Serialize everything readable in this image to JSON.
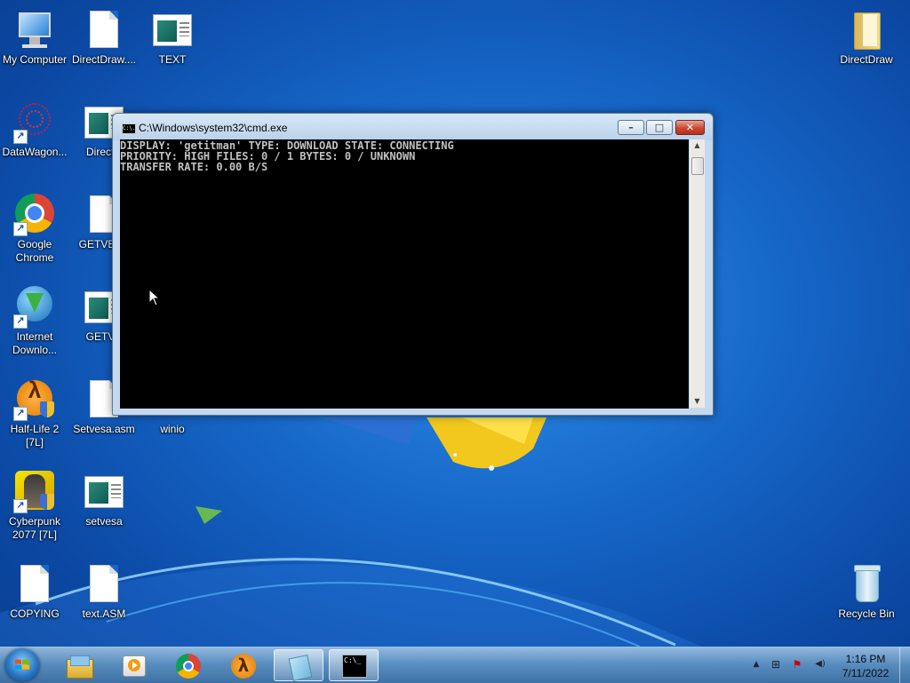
{
  "desktop": {
    "icons": [
      {
        "label": "My Computer"
      },
      {
        "label": "DirectDraw...."
      },
      {
        "label": "TEXT"
      },
      {
        "label": "DirectDraw"
      },
      {
        "label": "DataWagon..."
      },
      {
        "label": "DirectD"
      },
      {
        "label": "Google Chrome"
      },
      {
        "label": "GETVESA"
      },
      {
        "label": "Internet Downlo..."
      },
      {
        "label": "GETVE"
      },
      {
        "label": "Half-Life 2 [7L]"
      },
      {
        "label": "Setvesa.asm"
      },
      {
        "label": "winio"
      },
      {
        "label": "Cyberpunk 2077 [7L]"
      },
      {
        "label": "setvesa"
      },
      {
        "label": "COPYING"
      },
      {
        "label": "text.ASM"
      },
      {
        "label": "Recycle Bin"
      }
    ]
  },
  "cmd_window": {
    "title": "C:\\Windows\\system32\\cmd.exe",
    "icon_text": "C:\\.",
    "lines": [
      "DISPLAY: 'getitman' TYPE: DOWNLOAD STATE: CONNECTING",
      "PRIORITY: HIGH FILES: 0 / 1 BYTES: 0 / UNKNOWN",
      "TRANSFER RATE: 0.00 B/S"
    ],
    "scroll_up_glyph": "▲",
    "scroll_down_glyph": "▼"
  },
  "window_buttons": {
    "minimize": "–",
    "maximize": "□",
    "close": "✕"
  },
  "taskbar": {
    "start_icon": "windows-logo-icon",
    "pinned": [
      {
        "name": "explorer-icon"
      },
      {
        "name": "media-player-icon"
      },
      {
        "name": "chrome-icon"
      },
      {
        "name": "half-life-icon"
      },
      {
        "name": "notepad-icon"
      },
      {
        "name": "cmd-icon",
        "text": "C:\\_"
      }
    ],
    "tray": {
      "overflow_glyph": "▲",
      "network_glyph": "⊞",
      "action_center_glyph": "⚑",
      "volume_glyph": "◀)"
    },
    "clock": {
      "time": "1:16 PM",
      "date": "7/11/2022"
    }
  },
  "colors": {
    "console_bg": "#000000",
    "console_fg": "#c0c0c0",
    "desktop_blue": "#1667c8"
  }
}
